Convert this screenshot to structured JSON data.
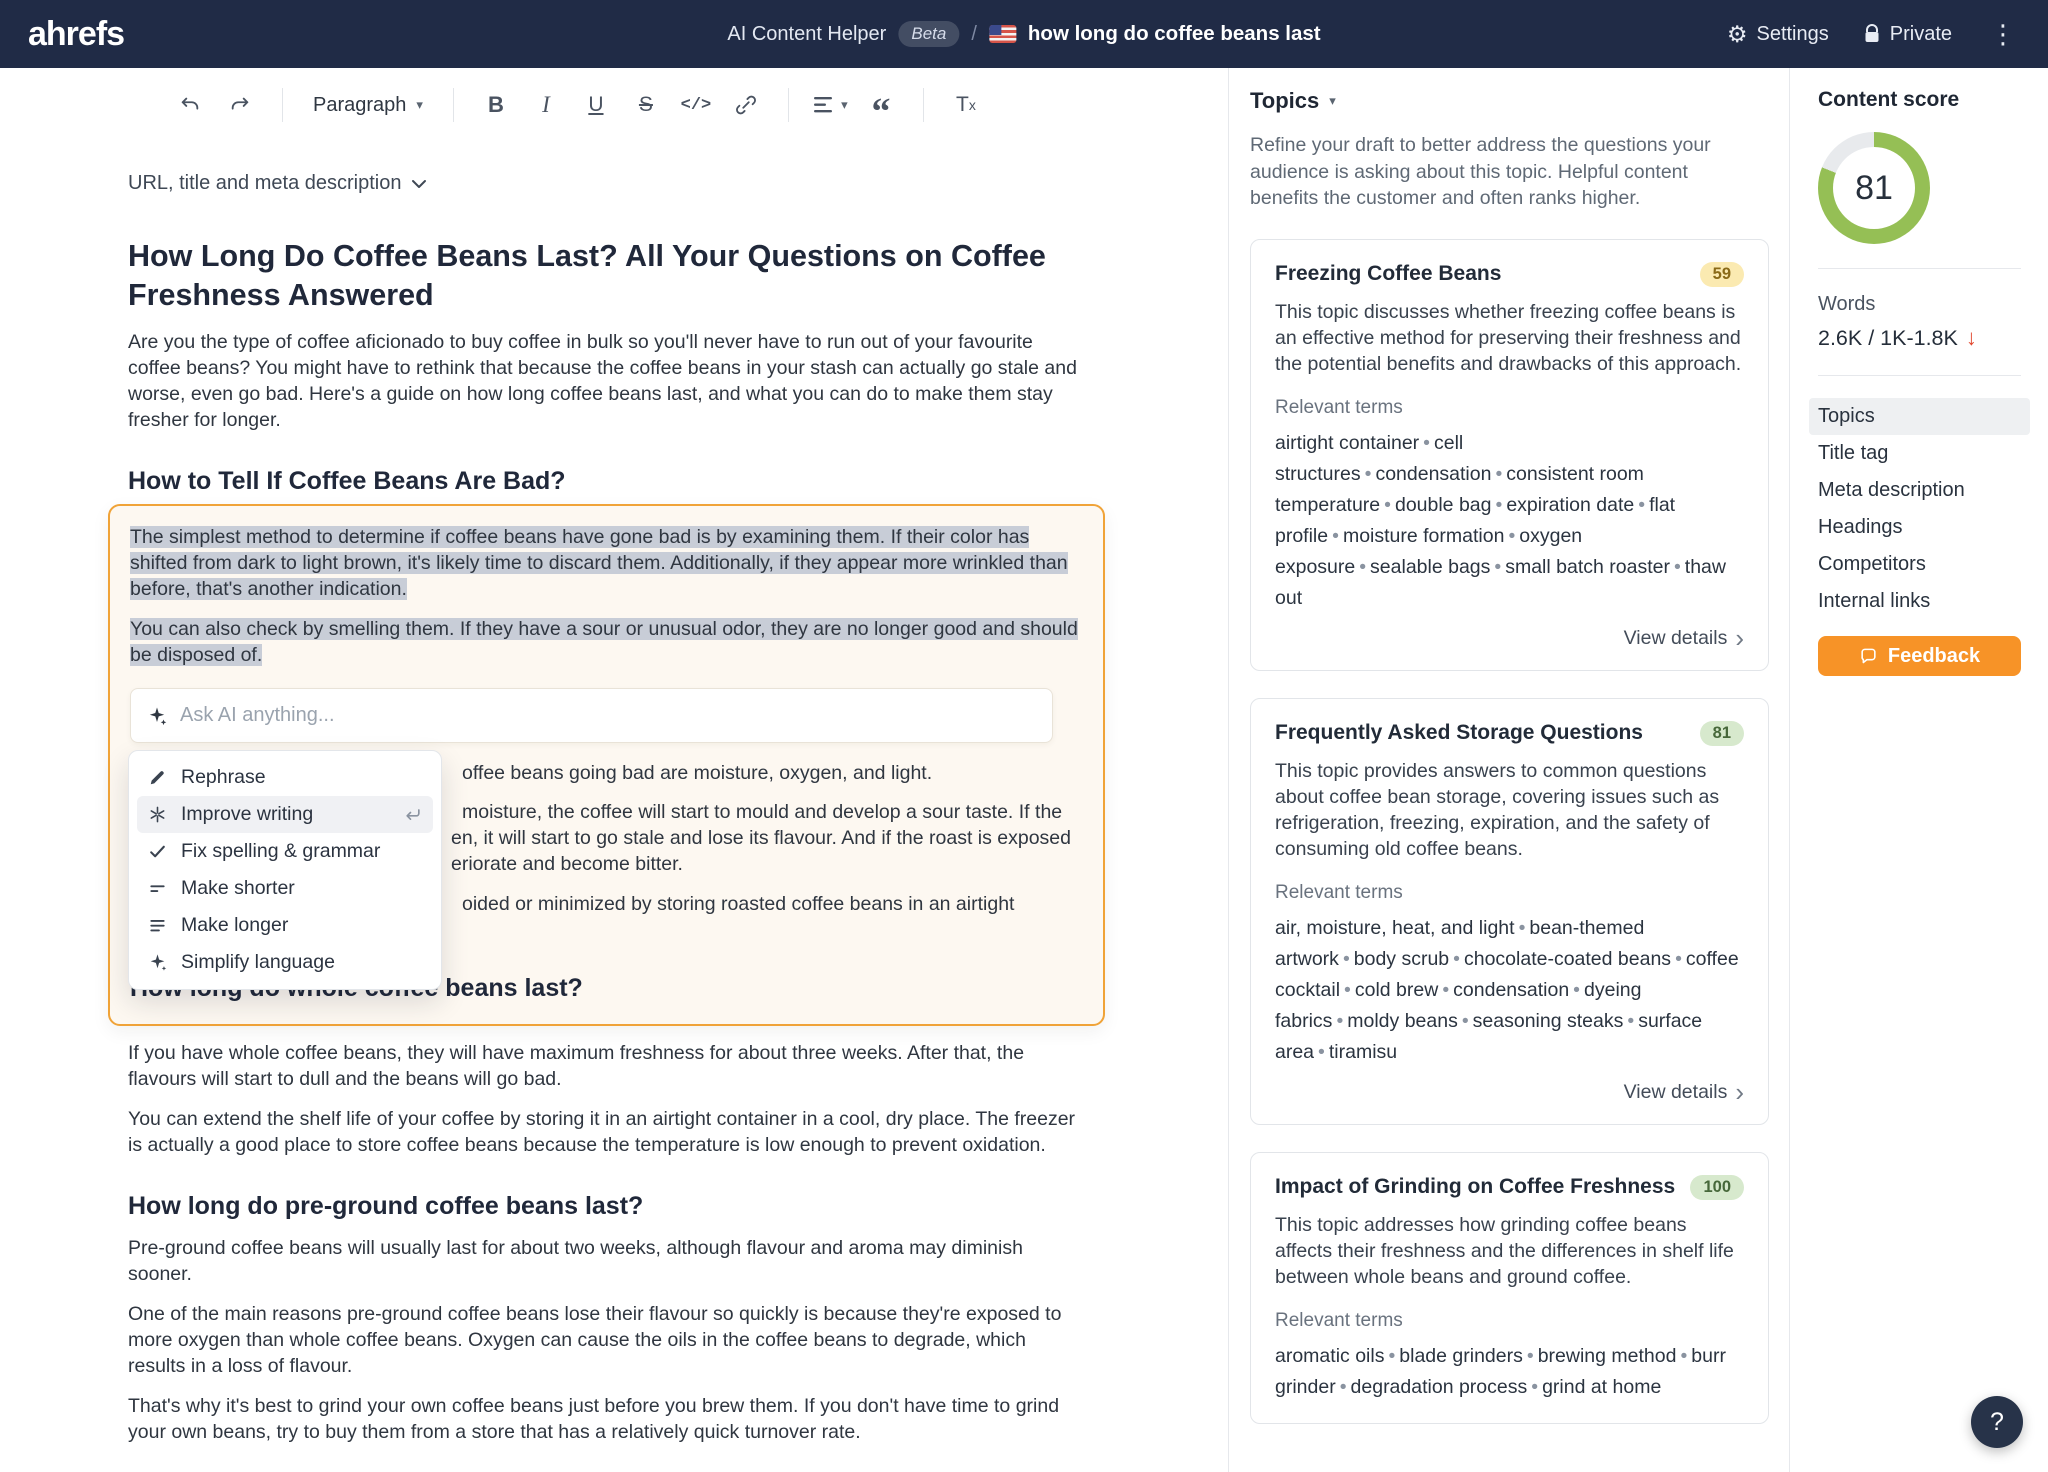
{
  "navbar": {
    "logo": "ahrefs",
    "app_name": "AI Content Helper",
    "beta": "Beta",
    "separator": "/",
    "doc_title": "how long do coffee beans last",
    "settings_label": "Settings",
    "private_label": "Private"
  },
  "toolbar": {
    "paragraph_label": "Paragraph",
    "bold": "B",
    "italic": "I",
    "underline": "U",
    "strike": "S",
    "code": "</>",
    "quote": "“",
    "clear_t": "T",
    "clear_x": "x"
  },
  "editor": {
    "url_meta_label": "URL, title and meta description",
    "h1": "How Long Do Coffee Beans Last? All Your Questions on Coffee Freshness Answered",
    "intro": "Are you the type of coffee aficionado to buy coffee in bulk so you'll never have to run out of your favourite coffee beans? You might have to rethink that because the coffee beans in your stash can actually go stale and worse, even go bad. Here's a guide on how long coffee beans last, and what you can do to make them stay fresher for longer.",
    "h2_bad": "How to Tell If Coffee Beans Are Bad?",
    "selection": {
      "p1": "The simplest method to determine if coffee beans have gone bad is by examining them. If their color has shifted from dark to light brown, it's likely time to discard them. Additionally, if they appear more wrinkled than before, that's another indication.",
      "p2": "You can also check by smelling them. If they have a sour or unusual odor, they are no longer good and should be disposed of."
    },
    "ask_ai_placeholder": "Ask AI anything...",
    "menu": {
      "active_index": 1,
      "items": [
        "Rephrase",
        "Improve writing",
        "Fix spelling & grammar",
        "Make shorter",
        "Make longer",
        "Simplify language"
      ]
    },
    "fragments": [
      "offee beans going bad are moisture, oxygen, and light.",
      "moisture, the coffee will start to mould and develop a sour taste. If the",
      "en, it will start to go stale and lose its flavour. And if the roast is exposed",
      "eriorate and become bitter.",
      "oided or minimized by storing roasted coffee beans in an airtight"
    ],
    "h2_whole": "How long do whole coffee beans last?",
    "p_whole_1": "If you have whole coffee beans, they will have maximum freshness for about three weeks. After that, the flavours will start to dull and the beans will go bad.",
    "p_whole_2": "You can extend the shelf life of your coffee by storing it in an airtight container in a cool, dry place. The freezer is actually a good place to store coffee beans because the temperature is low enough to prevent oxidation.",
    "h2_preground": "How long do pre-ground coffee beans last?",
    "p_pre_1": "Pre-ground coffee beans will usually last for about two weeks, although flavour and aroma may diminish sooner.",
    "p_pre_2": "One of the main reasons pre-ground coffee beans lose their flavour so quickly is because they're exposed to more oxygen than whole coffee beans. Oxygen can cause the oils in the coffee beans to degrade, which results in a loss of flavour.",
    "p_pre_3": "That's why it's best to grind your own coffee beans just before you brew them. If you don't have time to grind your own beans, try to buy them from a store that has a relatively quick turnover rate."
  },
  "topics": {
    "title": "Topics",
    "description": "Refine your draft to better address the questions your audience is asking about this topic. Helpful content benefits the customer and often ranks higher.",
    "relevant_terms_label": "Relevant terms",
    "view_details_label": "View details",
    "cards": [
      {
        "title": "Freezing Coffee Beans",
        "score": "59",
        "description": "This topic discusses whether freezing coffee beans is an effective method for preserving their freshness and the potential benefits and drawbacks of this approach.",
        "terms": [
          "airtight container",
          "cell structures",
          "condensation",
          "consistent room temperature",
          "double bag",
          "expiration date",
          "flat profile",
          "moisture formation",
          "oxygen exposure",
          "sealable bags",
          "small batch roaster",
          "thaw out"
        ]
      },
      {
        "title": "Frequently Asked Storage Questions",
        "score": "81",
        "description": "This topic provides answers to common questions about coffee bean storage, covering issues such as refrigeration, freezing, expiration, and the safety of consuming old coffee beans.",
        "terms": [
          "air, moisture, heat, and light",
          "bean-themed artwork",
          "body scrub",
          "chocolate-coated beans",
          "coffee cocktail",
          "cold brew",
          "condensation",
          "dyeing fabrics",
          "moldy beans",
          "seasoning steaks",
          "surface area",
          "tiramisu"
        ]
      },
      {
        "title": "Impact of Grinding on Coffee Freshness",
        "score": "100",
        "description": "This topic addresses how grinding coffee beans affects their freshness and the differences in shelf life between whole beans and ground coffee.",
        "terms": [
          "aromatic oils",
          "blade grinders",
          "brewing method",
          "burr grinder",
          "degradation process",
          "grind at home"
        ]
      }
    ]
  },
  "sidebar": {
    "content_score_label": "Content score",
    "score": "81",
    "score_percent": 81,
    "words_label": "Words",
    "words_value": "2.6K / 1K-1.8K",
    "words_arrow": "↓",
    "nav_active_index": 0,
    "nav": [
      "Topics",
      "Title tag",
      "Meta description",
      "Headings",
      "Competitors",
      "Internal links"
    ],
    "feedback_label": "Feedback",
    "help_label": "?"
  },
  "colors": {
    "accent_orange": "#f79327",
    "selection_border": "#f0a338",
    "score_green": "#95bf55",
    "donut_track": "#e8eaed",
    "badge_yellow_bg": "#fbeab1",
    "badge_green_bg": "#d7e9cd",
    "navy": "#202b46",
    "text_highlight": "#c8cdd7",
    "words_arrow_red": "#e2492f"
  }
}
